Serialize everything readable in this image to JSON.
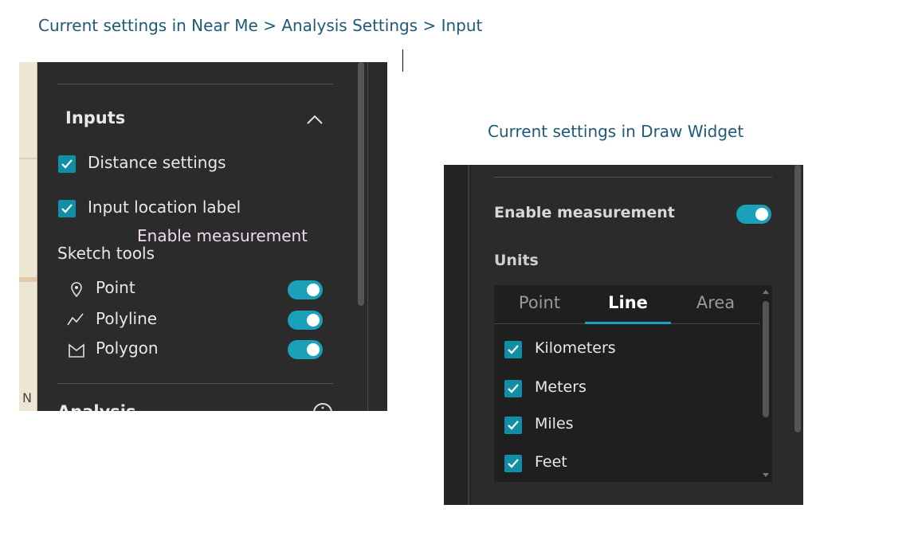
{
  "captions": {
    "left": "Current settings in Near Me > Analysis Settings > Input",
    "right": "Current settings in Draw Widget"
  },
  "overlay_label": "Enable measurement",
  "near_me_panel": {
    "section_title": "Inputs",
    "map_label": "N",
    "checkboxes": [
      {
        "label": "Distance settings",
        "checked": true
      },
      {
        "label": "Input location label",
        "checked": true
      }
    ],
    "sketch_tools_title": "Sketch tools",
    "tools": [
      {
        "label": "Point",
        "icon": "map-pin-icon",
        "enabled": true
      },
      {
        "label": "Polyline",
        "icon": "polyline-icon",
        "enabled": true
      },
      {
        "label": "Polygon",
        "icon": "polygon-icon",
        "enabled": true
      }
    ],
    "next_section_title": "Analysis"
  },
  "draw_widget_panel": {
    "enable_measurement_label": "Enable measurement",
    "enable_measurement_on": true,
    "units_title": "Units",
    "tabs": [
      {
        "label": "Point",
        "active": false
      },
      {
        "label": "Line",
        "active": true
      },
      {
        "label": "Area",
        "active": false
      }
    ],
    "units": [
      {
        "label": "Kilometers",
        "checked": true
      },
      {
        "label": "Meters",
        "checked": true
      },
      {
        "label": "Miles",
        "checked": true
      },
      {
        "label": "Feet",
        "checked": true
      }
    ]
  },
  "colors": {
    "accent": "#1aa0b8",
    "checkbox": "#0f8fa3",
    "panel_bg": "#2b2b2b",
    "caption": "#1e5a78",
    "overlay_text": "#f3d9ef"
  }
}
